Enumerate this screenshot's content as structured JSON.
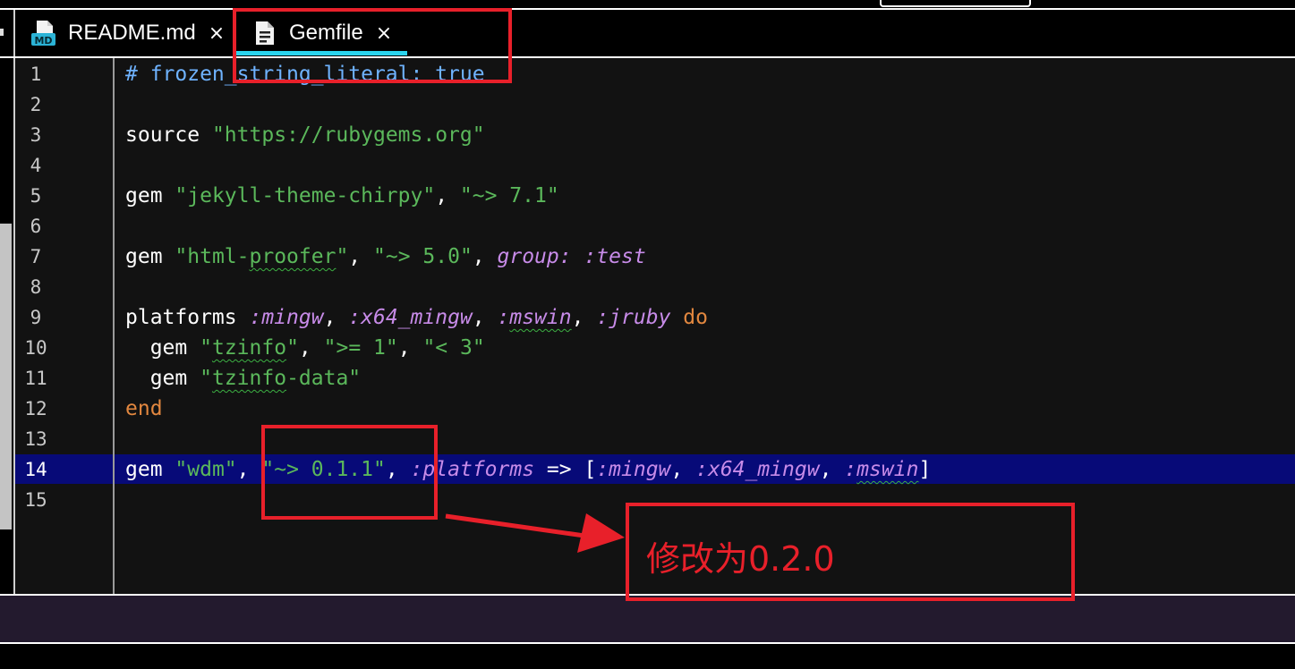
{
  "tabs": [
    {
      "label": "README.md",
      "icon": "markdown-file-icon",
      "close": "×",
      "active": false
    },
    {
      "label": "Gemfile",
      "icon": "document-file-icon",
      "close": "×",
      "active": true
    }
  ],
  "editor": {
    "current_line": 14,
    "line_numbers": [
      "1",
      "2",
      "3",
      "4",
      "5",
      "6",
      "7",
      "8",
      "9",
      "10",
      "11",
      "12",
      "13",
      "14",
      "15"
    ],
    "lines": {
      "l1": {
        "comment": "# frozen_string_literal: true"
      },
      "l3": {
        "kw": "source",
        "str": "\"https://rubygems.org\""
      },
      "l5": {
        "kw": "gem",
        "s1": "\"jekyll-theme-chirpy\"",
        "c1": ",",
        "s2": "\"~> 7.1\""
      },
      "l7": {
        "kw": "gem",
        "q1": "\"html-",
        "sq": "proofer",
        "q2": "\"",
        "c1": ",",
        "s2": "\"~> 5.0\"",
        "c2": ",",
        "sym": "group: :test"
      },
      "l9": {
        "kw": "platforms",
        "y1": ":mingw",
        "c1": ",",
        "y2": ":x64_mingw",
        "c2": ",",
        "y3a": ":",
        "y3b": "mswin",
        "c3": ",",
        "y4": ":jruby",
        "kw2": "do"
      },
      "l10": {
        "kw": "  gem",
        "q1": "\"",
        "sq": "tzinfo",
        "q2": "\"",
        "c1": ",",
        "s2": "\">= 1\"",
        "c2": ",",
        "s3": "\"< 3\""
      },
      "l11": {
        "kw": "  gem",
        "q1": "\"",
        "sq": "tzinfo",
        "q2": "-data\""
      },
      "l12": {
        "kw": "end"
      },
      "l14": {
        "kw": "gem",
        "s1": "\"wdm\"",
        "c1": ",",
        "s2": "\"~> 0.1.1\"",
        "c2": ",",
        "y1": ":platforms",
        "op": "=> [",
        "y2": ":mingw",
        "c3": ",",
        "y3": ":x64_mingw",
        "c4": ",",
        "y4a": ":",
        "y4b": "mswin",
        "close": "]"
      }
    }
  },
  "annotation": {
    "text": "修改为0.2.0",
    "color": "#e8202a"
  },
  "colors": {
    "accent_tab_underline": "#2ad4ee",
    "current_line_bg": "#070a78",
    "string": "#5bb85b",
    "symbol": "#c78be8",
    "keyword": "#e2873f",
    "comment": "#6fb3ff"
  }
}
